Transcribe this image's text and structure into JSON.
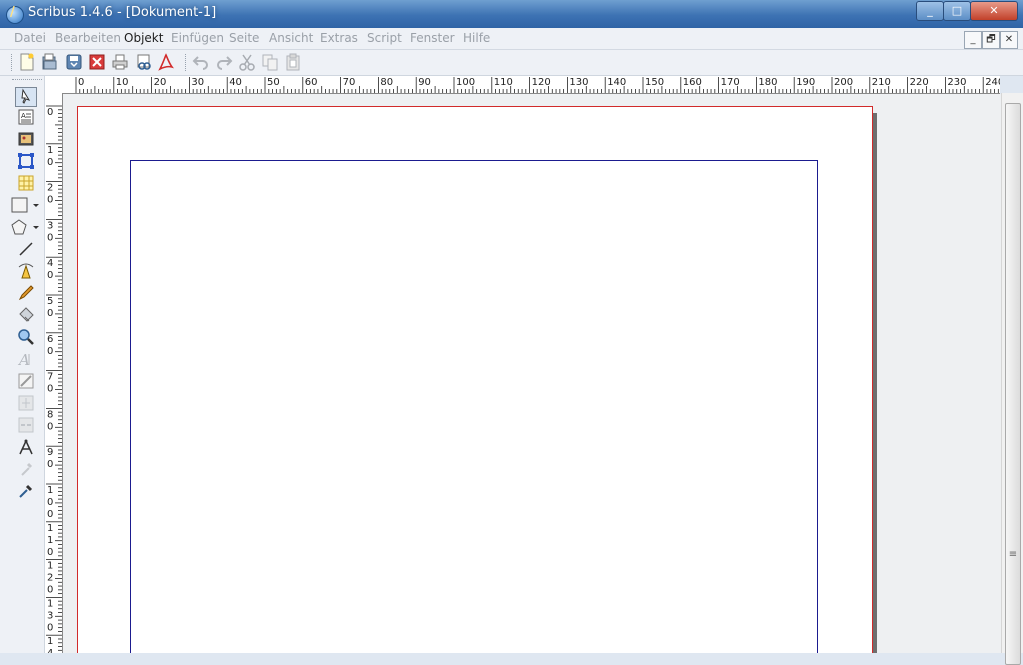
{
  "window": {
    "title": "Scribus 1.4.6 - [Dokument-1]"
  },
  "window_buttons": {
    "minimize": "_",
    "maximize": "□",
    "close": "✕"
  },
  "menu": {
    "items": [
      {
        "label": "Datei",
        "enabled": false
      },
      {
        "label": "Bearbeiten",
        "enabled": false
      },
      {
        "label": "Objekt",
        "enabled": true
      },
      {
        "label": "Einfügen",
        "enabled": false
      },
      {
        "label": "Seite",
        "enabled": false
      },
      {
        "label": "Ansicht",
        "enabled": false
      },
      {
        "label": "Extras",
        "enabled": false
      },
      {
        "label": "Script",
        "enabled": false
      },
      {
        "label": "Fenster",
        "enabled": false
      },
      {
        "label": "Hilfe",
        "enabled": false
      }
    ]
  },
  "mdi_buttons": {
    "minimize": "_",
    "restore": "🗗",
    "close": "✕"
  },
  "toolbar": {
    "icons": [
      "new-document-icon",
      "open-icon",
      "save-icon",
      "close-document-icon",
      "print-icon",
      "preflight-icon",
      "export-pdf-icon",
      "undo-icon",
      "redo-icon",
      "cut-icon",
      "copy-icon",
      "paste-icon"
    ]
  },
  "toolbox": {
    "icons": [
      "select-icon",
      "text-frame-icon",
      "image-frame-icon",
      "render-frame-icon",
      "table-icon",
      "shape-icon",
      "polygon-icon",
      "line-icon",
      "bezier-icon",
      "freehand-icon",
      "rotate-icon",
      "zoom-icon",
      "edit-text-icon",
      "story-editor-icon",
      "link-frames-icon",
      "unlink-frames-icon",
      "measure-icon",
      "copy-properties-icon",
      "eyedropper-icon"
    ]
  },
  "ruler": {
    "h_labels": [
      "0",
      "10",
      "20",
      "30",
      "40",
      "50",
      "60",
      "70",
      "80",
      "90",
      "100",
      "110",
      "120",
      "130",
      "140",
      "150",
      "160",
      "170",
      "180",
      "190",
      "200",
      "210",
      "220",
      "230",
      "240"
    ],
    "v_labels": [
      [
        "0"
      ],
      [
        "1",
        "0"
      ],
      [
        "2",
        "0"
      ],
      [
        "3",
        "0"
      ],
      [
        "4",
        "0"
      ],
      [
        "5",
        "0"
      ],
      [
        "6",
        "0"
      ],
      [
        "7",
        "0"
      ],
      [
        "8",
        "0"
      ],
      [
        "9",
        "0"
      ],
      [
        "1",
        "0",
        "0"
      ],
      [
        "1",
        "1",
        "0"
      ],
      [
        "1",
        "2",
        "0"
      ],
      [
        "1",
        "3",
        "0"
      ],
      [
        "1",
        "4"
      ]
    ]
  },
  "colors": {
    "page_border": "#d12a2a",
    "margin_guides": "#1b1b8f",
    "titlebar": "#3d72b3"
  }
}
